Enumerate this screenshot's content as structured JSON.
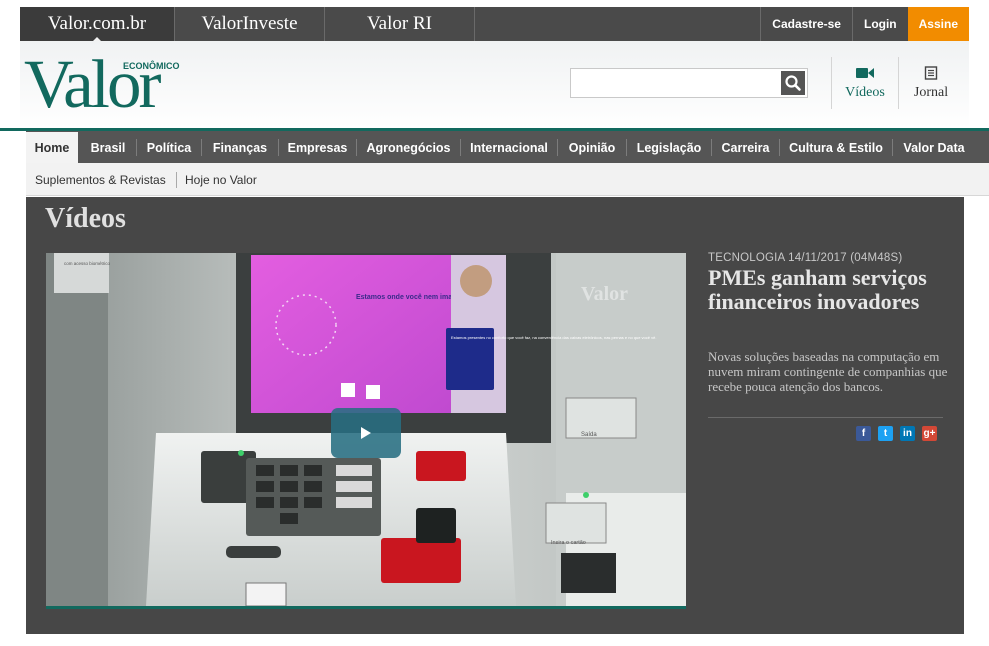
{
  "brands": {
    "tabs": [
      "Valor.com.br",
      "ValorInveste",
      "Valor RI"
    ]
  },
  "account": {
    "signup": "Cadastre-se",
    "login": "Login",
    "subscribe": "Assine"
  },
  "logo": {
    "name": "Valor",
    "tagline": "ECONÔMICO"
  },
  "search": {
    "placeholder": ""
  },
  "header_links": {
    "videos": "Vídeos",
    "journal": "Jornal"
  },
  "nav": {
    "items": [
      "Home",
      "Brasil",
      "Política",
      "Finanças",
      "Empresas",
      "Agronegócios",
      "Internacional",
      "Opinião",
      "Legislação",
      "Carreira",
      "Cultura & Estilo",
      "Valor Data"
    ]
  },
  "subnav": {
    "items": [
      "Suplementos & Revistas",
      "Hoje no Valor"
    ]
  },
  "video_section": {
    "title": "Vídeos",
    "featured": {
      "meta": "TECNOLOGIA 14/11/2017 (04M48S)",
      "headline": "PMEs ganham serviços financeiros inovadores",
      "summary": "Novas soluções baseadas na computação em nuvem miram contingente de companhias que recebe pouca atenção dos bancos."
    },
    "thumbnail_texts": {
      "screen_heading": "Estamos onde você nem imagina",
      "side_card": "Estamos presentes no conforto que você faz, na conveniência das caixas eletrônicos, nas pernas e no que você vê.",
      "watermark": "Valor",
      "label_saida": "Saída",
      "label_cartao": "Insira o cartão",
      "label_biometrico": "com acesso biométrico"
    }
  },
  "share": {
    "facebook": "f",
    "twitter": "t",
    "linkedin": "in",
    "googleplus": "g+"
  },
  "colors": {
    "brand_green": "#12695e",
    "accent_orange": "#f28c00",
    "section_bg": "#474747",
    "nav_bg": "#555555"
  }
}
